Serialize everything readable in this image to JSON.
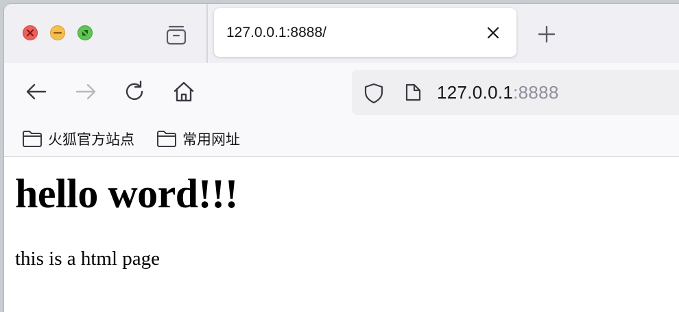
{
  "browser": {
    "active_tab": {
      "title": "127.0.0.1:8888/"
    },
    "url": {
      "host": "127.0.0.1",
      "port": ":8888"
    },
    "bookmarks": [
      {
        "label": "火狐官方站点",
        "icon": "folder-icon"
      },
      {
        "label": "常用网址",
        "icon": "folder-icon"
      }
    ],
    "icons": {
      "back": "arrow-left-icon",
      "forward": "arrow-right-icon",
      "reload": "reload-icon",
      "home": "home-icon",
      "shield": "shield-icon",
      "page": "page-icon",
      "tab_overview": "tab-overview-icon",
      "new_tab": "plus-icon",
      "close_tab": "close-icon"
    }
  },
  "page": {
    "heading": "hello word!!!",
    "paragraph": "this is a html page"
  },
  "colors": {
    "close": "#ee5f59",
    "minimize": "#f6be4f",
    "maximize": "#5ec454",
    "toolbar": "#f9f9fb",
    "tabstrip": "#f0f0f4",
    "urlbar": "#efeff2",
    "port_text": "#8f8f9d"
  }
}
